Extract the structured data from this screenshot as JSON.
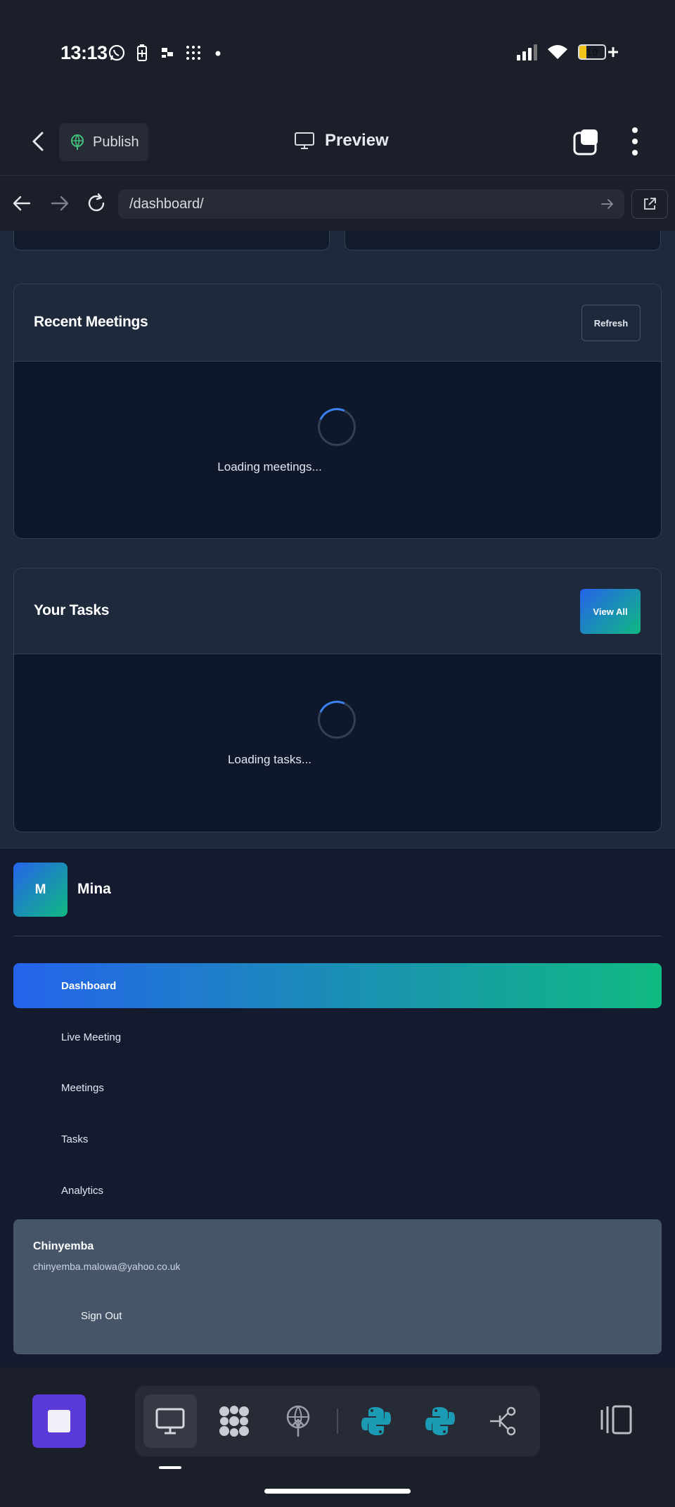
{
  "status_bar": {
    "time": "13:13",
    "battery_level": "10",
    "icons": [
      "whatsapp-icon",
      "battery-saver-icon",
      "app-icon",
      "grid-dots-icon",
      "dot-icon",
      "signal-icon",
      "wifi-icon",
      "battery-icon"
    ]
  },
  "header": {
    "publish_label": "Publish",
    "preview_label": "Preview"
  },
  "browser": {
    "url": "/dashboard/"
  },
  "recent_meetings": {
    "title": "Recent Meetings",
    "refresh_label": "Refresh",
    "loading_text": "Loading meetings..."
  },
  "tasks": {
    "title": "Your Tasks",
    "view_all_label": "View All",
    "loading_text": "Loading tasks..."
  },
  "sidebar": {
    "logo_letter": "M",
    "brand_name": "Mina",
    "items": [
      {
        "label": "Dashboard",
        "active": true
      },
      {
        "label": "Live Meeting",
        "active": false
      },
      {
        "label": "Meetings",
        "active": false
      },
      {
        "label": "Tasks",
        "active": false
      },
      {
        "label": "Analytics",
        "active": false
      }
    ],
    "user": {
      "name": "Chinyemba",
      "email": "chinyemba.malowa@yahoo.co.uk",
      "sign_out_label": "Sign Out"
    }
  },
  "colors": {
    "accent_gradient_start": "#2563eb",
    "accent_gradient_end": "#10b981",
    "stop_button": "#5b3bd8",
    "python_teal": "#1c9bb5"
  }
}
